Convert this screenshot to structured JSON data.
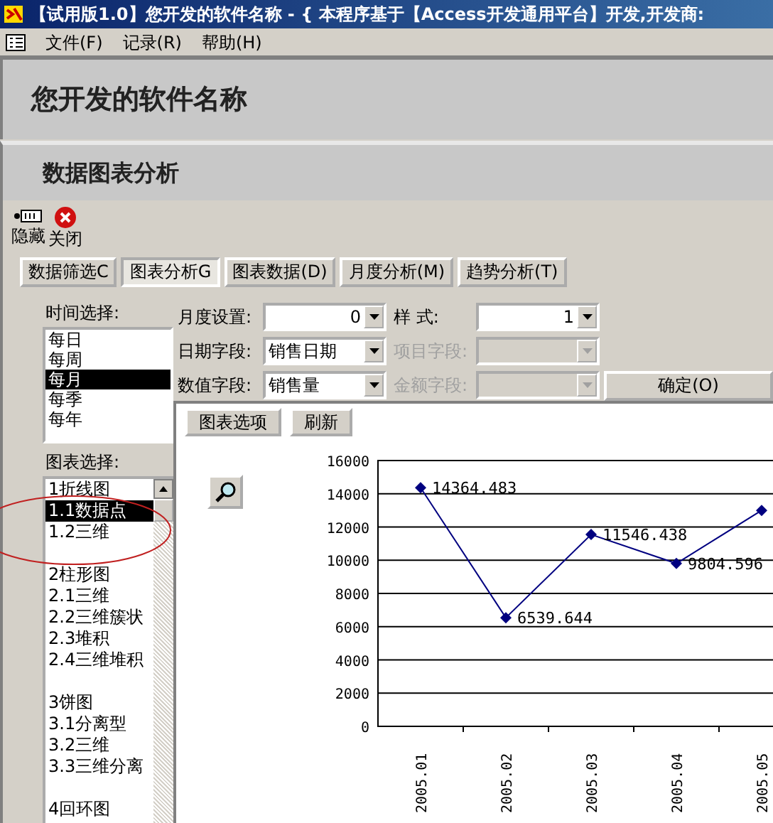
{
  "window": {
    "title": "【试用版1.0】您开发的软件名称 - { 本程序基于【Access开发通用平台】开发,开发商:"
  },
  "menu": [
    "文件(F)",
    "记录(R)",
    "帮助(H)"
  ],
  "header": {
    "title": "您开发的软件名称",
    "subtitle": "数据图表分析"
  },
  "toolbar": [
    {
      "kind": "hide",
      "label": "隐藏"
    },
    {
      "kind": "close",
      "label": "关闭"
    }
  ],
  "tabs": [
    {
      "label": "数据筛选C",
      "selected": false
    },
    {
      "label": "图表分析G",
      "selected": true
    },
    {
      "label": "图表数据(D)",
      "selected": false
    },
    {
      "label": "月度分析(M)",
      "selected": false
    },
    {
      "label": "趋势分析(T)",
      "selected": false
    }
  ],
  "time_select": {
    "label": "时间选择:",
    "items": [
      {
        "label": "每日",
        "selected": false
      },
      {
        "label": "每周",
        "selected": false
      },
      {
        "label": "每月",
        "selected": true
      },
      {
        "label": "每季",
        "selected": false
      },
      {
        "label": "每年",
        "selected": false
      }
    ]
  },
  "fields": [
    {
      "kind": "number",
      "label": "月度设置:",
      "value": "0",
      "disabled": false
    },
    {
      "kind": "number",
      "label": "样 式:",
      "value": "1",
      "disabled": false
    },
    {
      "kind": "text",
      "label": "日期字段:",
      "value": "销售日期",
      "disabled": false
    },
    {
      "kind": "text",
      "label": "项目字段:",
      "disabled": true
    },
    {
      "kind": "text",
      "label": "数值字段:",
      "value": "销售量",
      "disabled": false
    },
    {
      "kind": "text",
      "label": "金额字段:",
      "disabled": true
    }
  ],
  "confirm_button": "确定(O)",
  "chart_select": {
    "label": "图表选择:",
    "items": [
      {
        "kind": "group",
        "label": "1折线图",
        "selected": false
      },
      {
        "kind": "item",
        "label": "1.1数据点",
        "selected": true
      },
      {
        "kind": "item",
        "label": "1.2三维",
        "selected": false
      },
      {
        "kind": "group",
        "label": "2柱形图",
        "selected": false
      },
      {
        "kind": "item",
        "label": "2.1三维",
        "selected": false
      },
      {
        "kind": "item",
        "label": "2.2三维簇状",
        "selected": false
      },
      {
        "kind": "item",
        "label": "2.3堆积",
        "selected": false
      },
      {
        "kind": "item",
        "label": "2.4三维堆积",
        "selected": false
      },
      {
        "kind": "group",
        "label": "3饼图",
        "selected": false
      },
      {
        "kind": "item",
        "label": "3.1分离型",
        "selected": false
      },
      {
        "kind": "item",
        "label": "3.2三维",
        "selected": false
      },
      {
        "kind": "item",
        "label": "3.3三维分离",
        "selected": false
      },
      {
        "kind": "group",
        "label": "4回环图",
        "selected": false
      }
    ]
  },
  "chart_panel": {
    "buttons": [
      "图表选项",
      "刷新"
    ],
    "chart_data": {
      "type": "line",
      "categories": [
        "2005.01",
        "2005.02",
        "2005.03",
        "2005.04",
        "2005.05"
      ],
      "series": [
        {
          "color": "#000080",
          "marker": "diamond",
          "values": [
            14364.483,
            6539.644,
            11546.438,
            9804.596,
            13000
          ]
        }
      ],
      "grid": true,
      "ylim": [
        0,
        16000
      ],
      "yticks": [
        0,
        2000,
        4000,
        6000,
        8000,
        10000,
        12000,
        14000,
        16000
      ],
      "value_labels": [
        "14364.483",
        "6539.644",
        "11546.438",
        "9804.596",
        null
      ]
    }
  }
}
